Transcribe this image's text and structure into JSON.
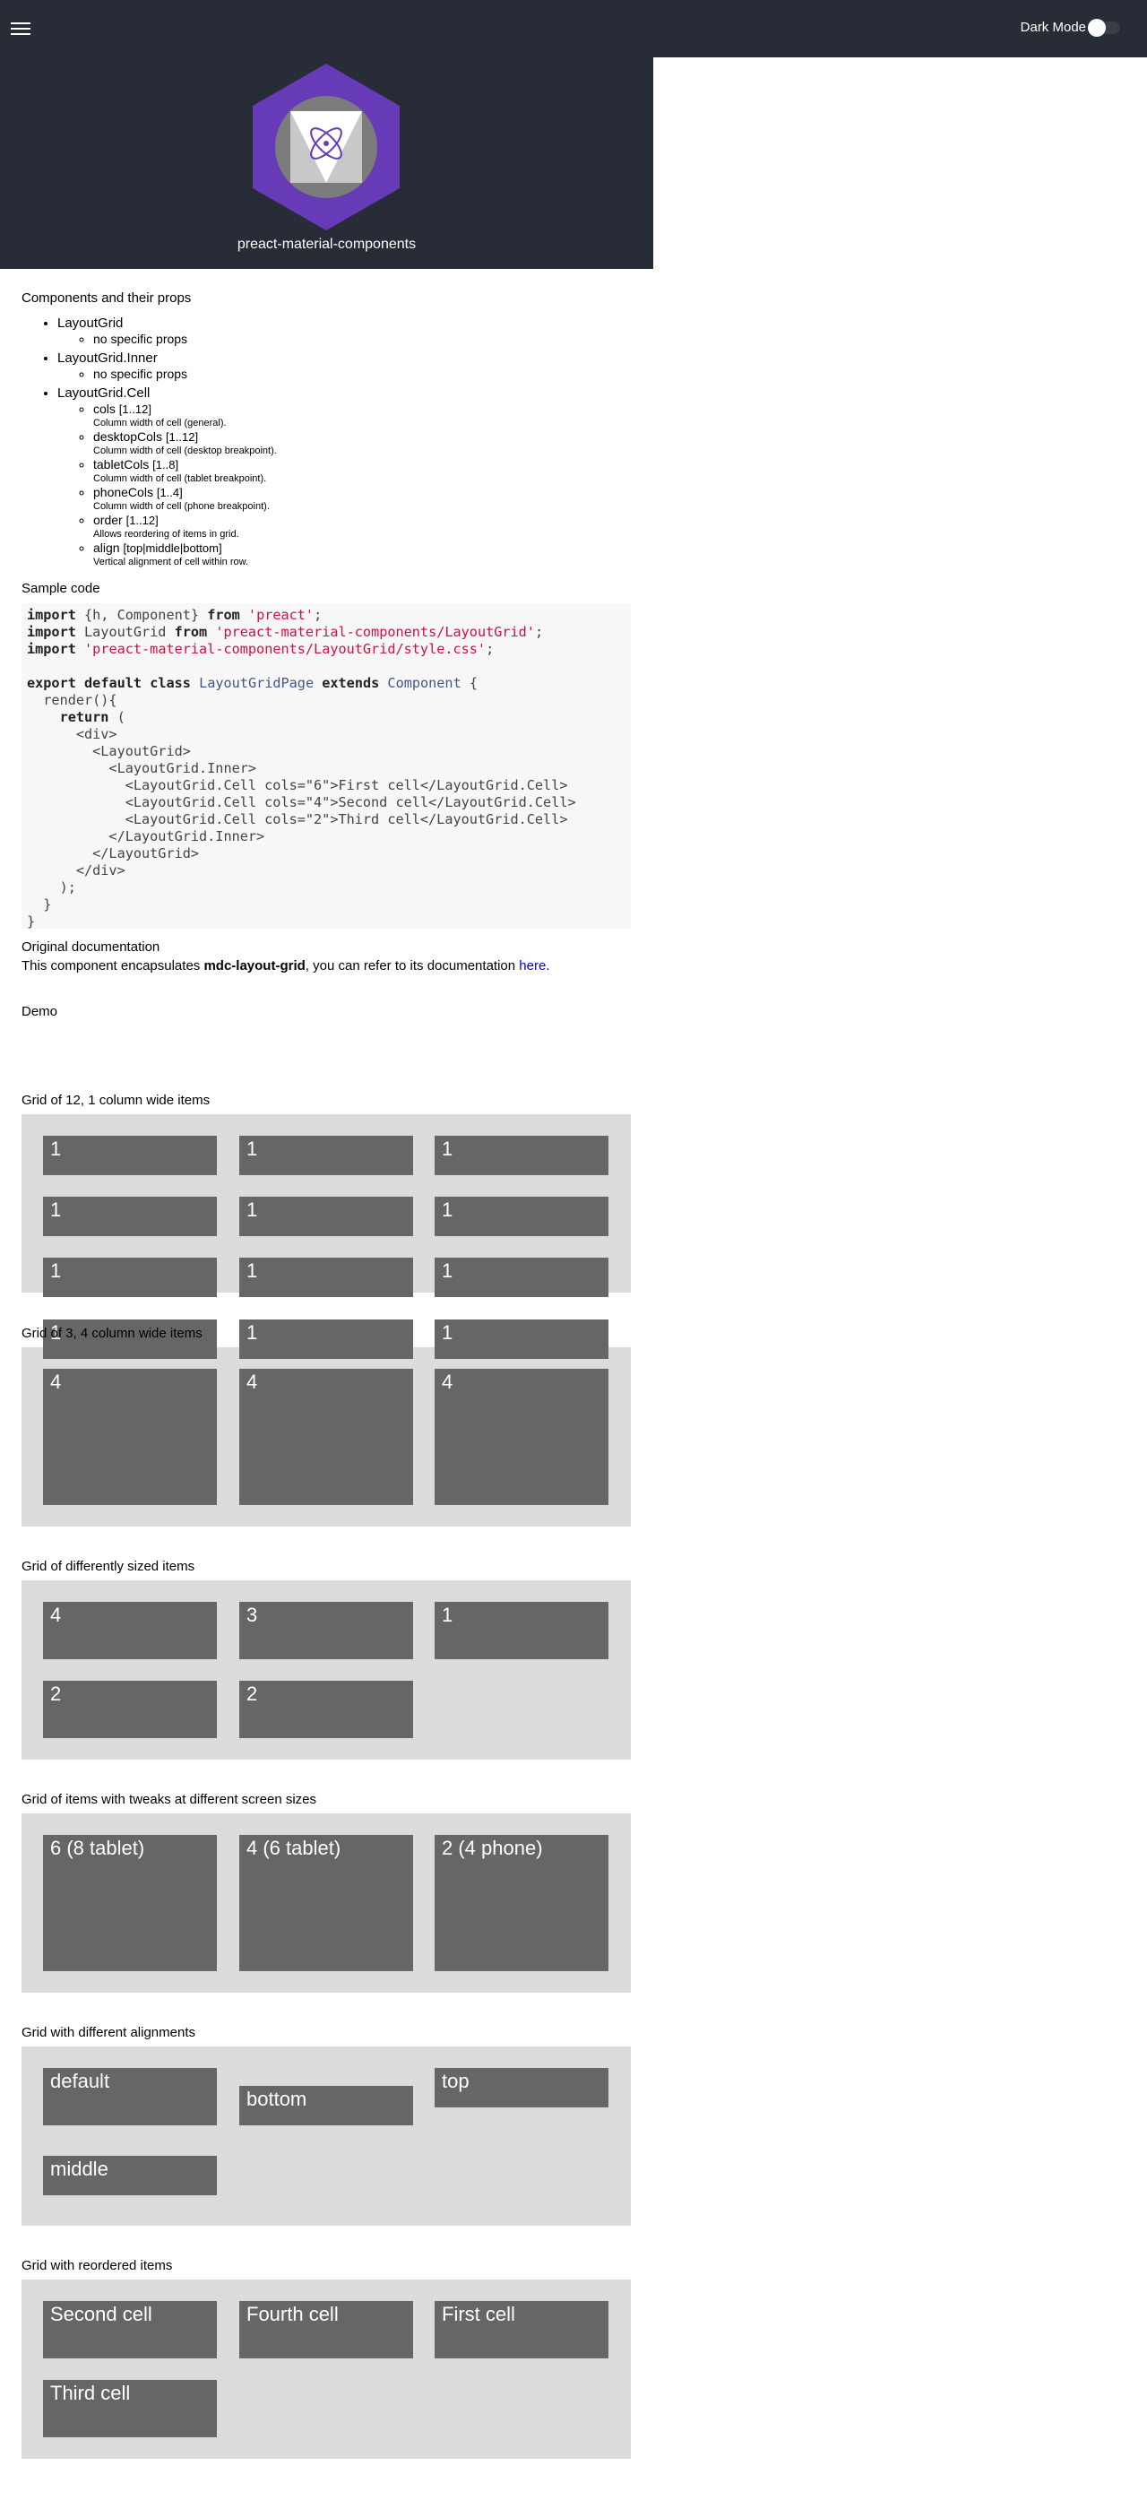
{
  "topbar": {
    "dark_mode_label": "Dark Mode"
  },
  "hero": {
    "title": "preact-material-components"
  },
  "props_section": {
    "heading": "Components and their props",
    "components": [
      {
        "name": "LayoutGrid",
        "note": "no specific props"
      },
      {
        "name": "LayoutGrid.Inner",
        "note": "no specific props"
      },
      {
        "name": "LayoutGrid.Cell",
        "props": [
          {
            "name": "cols",
            "range": "[1..12]",
            "desc": "Column width of cell (general)."
          },
          {
            "name": "desktopCols",
            "range": "[1..12]",
            "desc": "Column width of cell (desktop breakpoint)."
          },
          {
            "name": "tabletCols",
            "range": "[1..8]",
            "desc": "Column width of cell (tablet breakpoint)."
          },
          {
            "name": "phoneCols",
            "range": "[1..4]",
            "desc": "Column width of cell (phone breakpoint)."
          },
          {
            "name": "order",
            "range": "[1..12]",
            "desc": "Allows reordering of items in grid."
          },
          {
            "name": "align",
            "range": "[top|middle|bottom]",
            "desc": "Vertical alignment of cell within row."
          }
        ]
      }
    ]
  },
  "sample_code": {
    "heading": "Sample code",
    "lines": [
      "import {h, Component} from 'preact';",
      "import LayoutGrid from 'preact-material-components/LayoutGrid';",
      "import 'preact-material-components/LayoutGrid/style.css';",
      "",
      "export default class LayoutGridPage extends Component {",
      "  render(){",
      "    return (",
      "      <div>",
      "        <LayoutGrid>",
      "          <LayoutGrid.Inner>",
      "            <LayoutGrid.Cell cols=\"6\">First cell</LayoutGrid.Cell>",
      "            <LayoutGrid.Cell cols=\"4\">Second cell</LayoutGrid.Cell>",
      "            <LayoutGrid.Cell cols=\"2\">Third cell</LayoutGrid.Cell>",
      "          </LayoutGrid.Inner>",
      "        </LayoutGrid>",
      "      </div>",
      "    );",
      "  }",
      "}"
    ]
  },
  "documentation": {
    "heading": "Original documentation",
    "text_before": "This component encapsulates ",
    "bold": "mdc-layout-grid",
    "text_after": ", you can refer to its documentation ",
    "link": "here",
    "end": "."
  },
  "demo": {
    "heading": "Demo",
    "grids": [
      {
        "label": "Grid of 12, 1 column wide items",
        "cells": [
          "1",
          "1",
          "1",
          "1",
          "1",
          "1",
          "1",
          "1",
          "1",
          "1",
          "1",
          "1"
        ]
      },
      {
        "label": "Grid of 3, 4 column wide items",
        "cells": [
          "4",
          "4",
          "4"
        ]
      },
      {
        "label": "Grid of differently sized items",
        "cells": [
          "4",
          "3",
          "1",
          "2",
          "2"
        ]
      },
      {
        "label": "Grid of items with tweaks at different screen sizes",
        "cells": [
          "6 (8 tablet)",
          "4 (6 tablet)",
          "2 (4 phone)"
        ]
      },
      {
        "label": "Grid with different alignments",
        "cells": [
          "default",
          "bottom",
          "top",
          "middle"
        ]
      },
      {
        "label": "Grid with reordered items",
        "cells": [
          "Second cell",
          "Fourth cell",
          "First cell",
          "Third cell"
        ]
      }
    ]
  }
}
